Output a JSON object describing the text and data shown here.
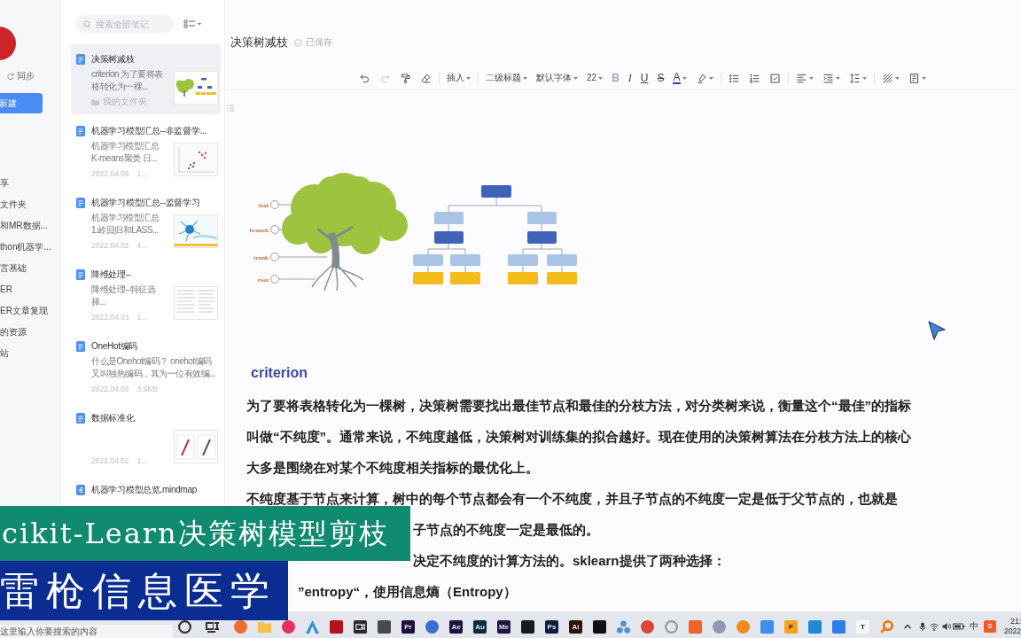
{
  "sidebar": {
    "sync": "同步",
    "new_button": "新建",
    "items": [
      "享",
      "文件夹",
      "和MR数据...",
      "thon机器学...",
      "言基础",
      "ER",
      "ER文章复现",
      "的资源",
      "站"
    ]
  },
  "note_list": {
    "search": {
      "placeholder": "搜索全部笔记"
    },
    "notes": [
      {
        "kind": "diagram",
        "title": "决策树减枝",
        "snippet": "criterion 为了要将表格转化为一棵...",
        "folder": "我的文件夹",
        "selected": true
      },
      {
        "kind": "scatter",
        "title": "机器学习模型汇总--非监督学...",
        "snippet": "机器学习模型汇总 K-means聚类 日...",
        "date": "2022.04.08",
        "size": "1...",
        "selected": false
      },
      {
        "kind": "network",
        "title": "机器学习模型汇总--监督学习",
        "snippet": "机器学习模型汇总 1.岭回归和LASS...",
        "date": "2022.04.02",
        "size": "4...",
        "selected": false
      },
      {
        "kind": "table",
        "title": "降维处理--",
        "snippet": "降维处理--特征选择...",
        "date": "2022.04.03",
        "size": "1...",
        "selected": false
      },
      {
        "kind": "text",
        "title": "OneHot编码",
        "snippet": "什么是Onehot编码？ onehot编码又叫独热编码，其为一位有效编...",
        "date": "2022.04.03",
        "size": "3.6KB",
        "selected": false
      },
      {
        "kind": "plots",
        "title": "数据标准化",
        "date": "2022.04.02",
        "size": "1...",
        "selected": false
      },
      {
        "kind": "mindmap",
        "title": "机器学习模型总览.mindmap",
        "selected": false
      }
    ]
  },
  "editor": {
    "title": "决策树减枝",
    "save_status": "已保存",
    "toolbar": [
      [
        {
          "kind": "undo",
          "disabled": false
        },
        {
          "kind": "redo",
          "disabled": true
        },
        {
          "kind": "format-painter",
          "disabled": false
        },
        {
          "kind": "eraser",
          "disabled": false
        }
      ],
      [
        {
          "kind": "dropdown",
          "label": "插入",
          "disabled": false
        }
      ],
      [
        {
          "kind": "dropdown",
          "label": "二级标题",
          "disabled": false
        },
        {
          "kind": "dropdown",
          "label": "默认字体",
          "disabled": false
        },
        {
          "kind": "dropdown",
          "label": "22",
          "disabled": false
        },
        {
          "kind": "bold",
          "label": "B",
          "disabled": true
        },
        {
          "kind": "italic",
          "label": "I",
          "disabled": false
        },
        {
          "kind": "underline",
          "label": "U",
          "disabled": false
        },
        {
          "kind": "strike",
          "label": "S",
          "disabled": false
        },
        {
          "kind": "font-color",
          "label": "A",
          "disabled": false
        },
        {
          "kind": "highlight",
          "disabled": false
        }
      ],
      [
        {
          "kind": "bullet-list",
          "disabled": false
        },
        {
          "kind": "numbered-list",
          "disabled": false
        },
        {
          "kind": "checklist",
          "disabled": false
        }
      ],
      [
        {
          "kind": "align",
          "disabled": false
        },
        {
          "kind": "indent",
          "disabled": false
        },
        {
          "kind": "line-spacing",
          "disabled": false
        }
      ],
      [
        {
          "kind": "shading",
          "disabled": false
        },
        {
          "kind": "template",
          "disabled": false
        }
      ]
    ],
    "figure": {
      "callouts": [
        "leaf",
        "branch",
        "trunk",
        "root"
      ]
    },
    "heading": "criterion",
    "paragraphs": [
      "为了要将表格转化为一棵树，决策树需要找出最佳节点和最佳的分枝方法，对分类树来说，衡量这个“最佳”的指标叫做“不纯度”。通常来说，不纯度越低，决策树对训练集的拟合越好。现在使用的决策树算法在分枝方法上的核心大多是围绕在对某个不纯度相关指标的最优化上。",
      "不纯度基于节点来计算，树中的每个节点都会有一个不纯度，并且子节点的不纯度一定是低于父节点的，也就是"
    ],
    "partly_covered_lines": [
      "子节点的不纯度一定是最低的。",
      "决定不纯度的计算方法的。sklearn提供了两种选择：",
      "”entropy“，使用信息熵（Entropy）"
    ]
  },
  "banners": {
    "title": "cikit-Learn决策树模型剪枝",
    "channel": "雷枪信息医学"
  },
  "taskbar": {
    "search": {
      "placeholder": "这里输入你要搜索的内容"
    },
    "apps": [
      {
        "kind": "ring",
        "color": "#333333"
      },
      {
        "kind": "task-view",
        "color": "#333333"
      },
      {
        "kind": "disc",
        "color": "#f06b2f"
      },
      {
        "kind": "folder",
        "color": "#f2c14b"
      },
      {
        "kind": "disc",
        "color": "#e5305f"
      },
      {
        "kind": "peak",
        "color": "#2d8fd5"
      },
      {
        "kind": "tile",
        "color": "#b3141c"
      },
      {
        "kind": "camera",
        "color": "#2b2b2b"
      },
      {
        "kind": "tile",
        "color": "#4a4a4a"
      },
      {
        "kind": "tile",
        "color": "#1e0f3c",
        "label": "Pr"
      },
      {
        "kind": "disc",
        "color": "#3b6ed0"
      },
      {
        "kind": "tile",
        "color": "#1b1540",
        "label": "Ae"
      },
      {
        "kind": "tile",
        "color": "#0b2a3d",
        "label": "Au"
      },
      {
        "kind": "tile",
        "color": "#1b1540",
        "label": "Me"
      },
      {
        "kind": "tile",
        "color": "#1a1a1a"
      },
      {
        "kind": "tile",
        "color": "#0b2038",
        "label": "Ps"
      },
      {
        "kind": "tile",
        "color": "#2b1400",
        "label": "Ai"
      },
      {
        "kind": "tile",
        "color": "#101010"
      },
      {
        "kind": "nodes",
        "color": "#4a90d9"
      },
      {
        "kind": "disc",
        "color": "#db4437"
      },
      {
        "kind": "ring",
        "color": "#9a9a9a"
      },
      {
        "kind": "tile",
        "color": "#f0642a"
      },
      {
        "kind": "disc",
        "color": "#8d9aad"
      },
      {
        "kind": "disc",
        "color": "#f5891e"
      },
      {
        "kind": "tile",
        "color": "#3d8df2"
      },
      {
        "kind": "tile",
        "color": "#f6a31f",
        "label": "F"
      },
      {
        "kind": "tile",
        "color": "#1f8ad2"
      },
      {
        "kind": "tile",
        "color": "#2f7ee6"
      },
      {
        "kind": "tile",
        "color": "#f7f7f7",
        "label": "T"
      },
      {
        "kind": "magnifier",
        "color": "#ea7b0c"
      }
    ],
    "tray": [
      {
        "kind": "caret"
      },
      {
        "kind": "mic"
      },
      {
        "kind": "wifi"
      },
      {
        "kind": "volume"
      },
      {
        "kind": "battery"
      },
      {
        "kind": "ime",
        "label": "中"
      },
      {
        "kind": "tile",
        "color": "#f05a28",
        "label": "S"
      }
    ],
    "clock": {
      "time": "21:",
      "date": "2022"
    }
  }
}
